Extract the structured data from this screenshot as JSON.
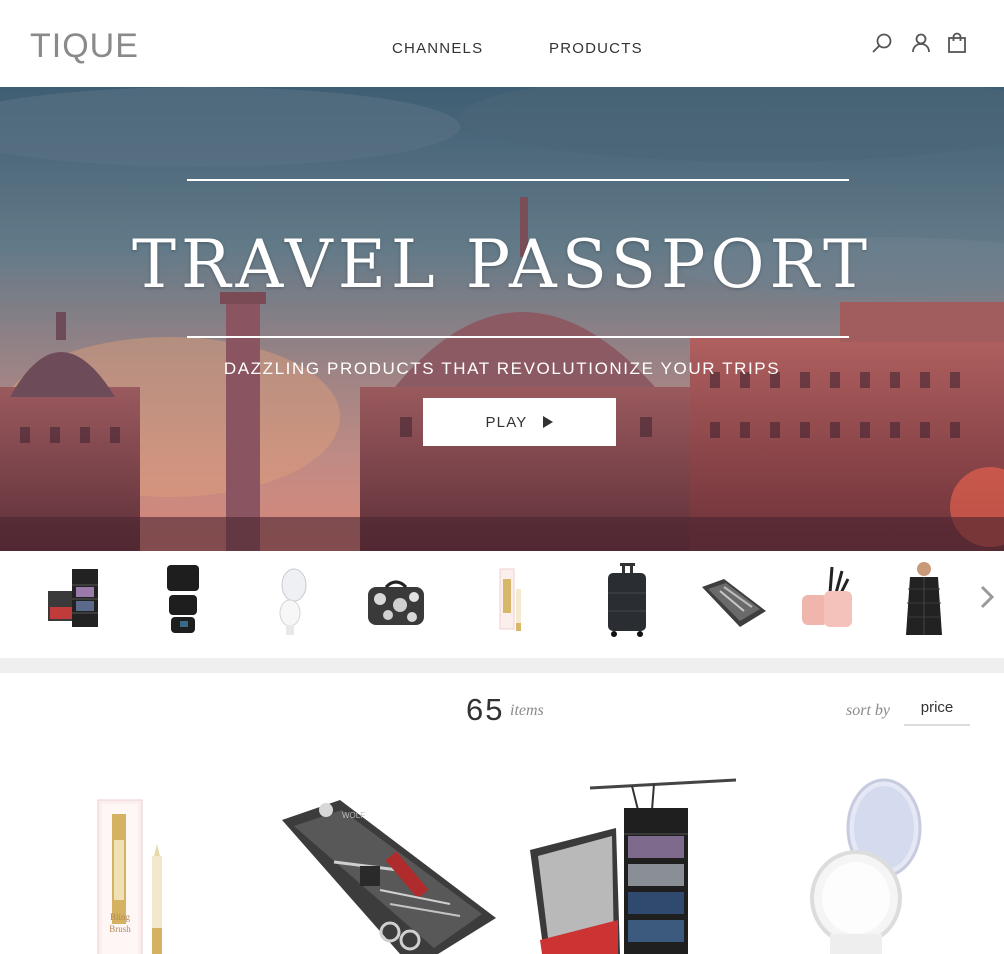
{
  "header": {
    "logo": "TIQUE",
    "nav": [
      {
        "label": "CHANNELS"
      },
      {
        "label": "PRODUCTS"
      }
    ],
    "icons": [
      "search-icon",
      "user-icon",
      "bag-icon"
    ]
  },
  "hero": {
    "title": "TRAVEL PASSPORT",
    "subtitle": "DAZZLING PRODUCTS THAT REVOLUTIONIZE YOUR TRIPS",
    "play_label": "PLAY"
  },
  "thumbnails": [
    {
      "icon": "closet-organizer-thumbnail"
    },
    {
      "icon": "packing-cubes-thumbnail"
    },
    {
      "icon": "compact-mirror-thumbnail"
    },
    {
      "icon": "floral-cosmetic-case-thumbnail"
    },
    {
      "icon": "bling-brush-thumbnail"
    },
    {
      "icon": "rolling-suitcase-thumbnail"
    },
    {
      "icon": "manicure-kit-thumbnail"
    },
    {
      "icon": "pink-brush-holder-thumbnail"
    },
    {
      "icon": "puffer-jacket-thumbnail"
    }
  ],
  "listing": {
    "count": "65",
    "count_label": "items",
    "sort_label": "sort by",
    "sort_value": "price"
  },
  "products": [
    {
      "icon": "bling-brush-product-image"
    },
    {
      "icon": "manicure-kit-product-image"
    },
    {
      "icon": "suitcase-closet-product-image"
    },
    {
      "icon": "lighted-mirror-product-image"
    }
  ],
  "colors": {
    "accent_text": "#333333",
    "muted_text": "#8a8a8a",
    "band": "#efefef"
  }
}
